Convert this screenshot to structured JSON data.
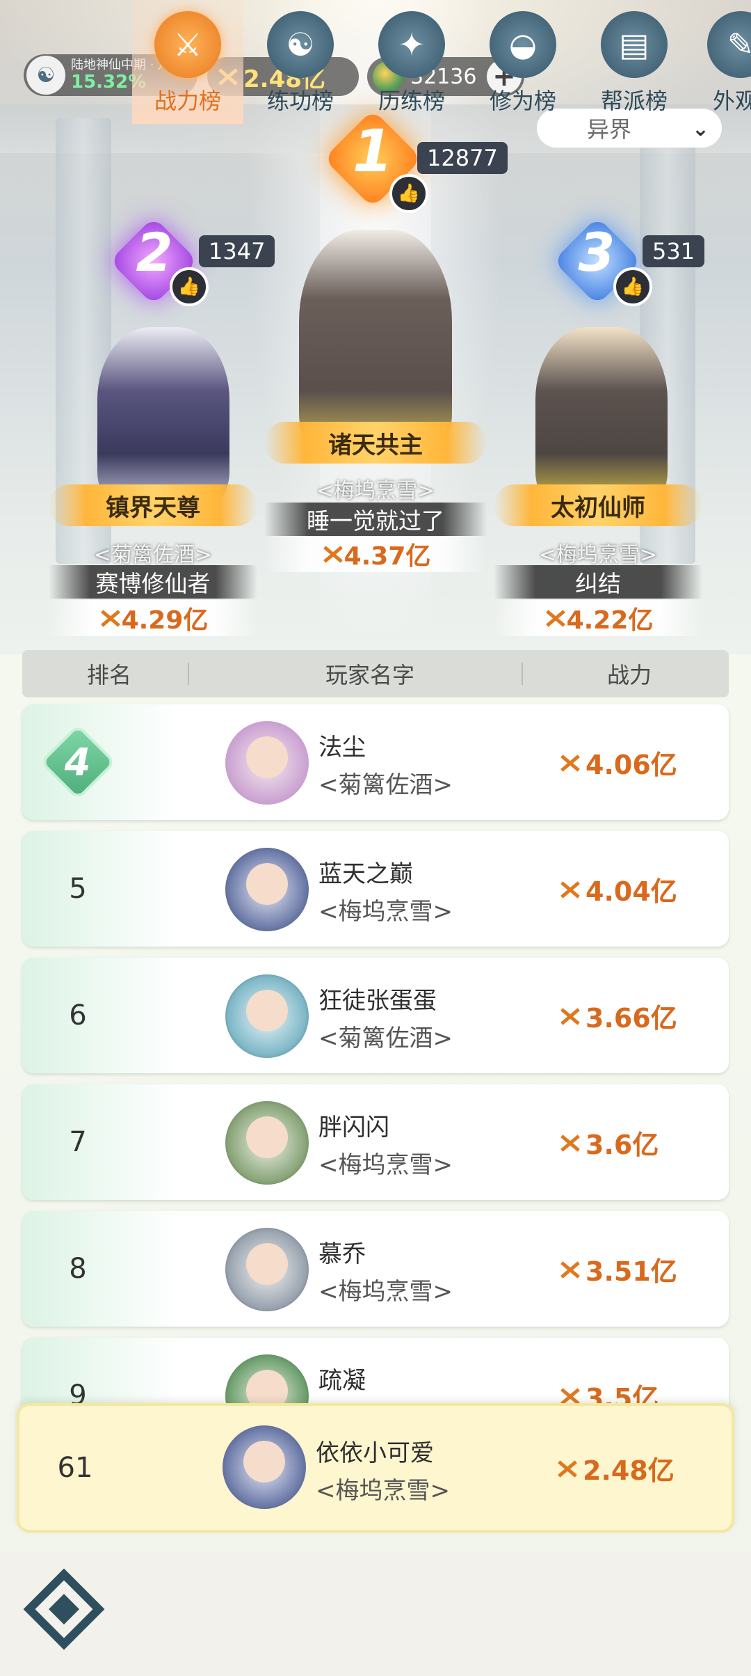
{
  "top_bar": {
    "realm_name": "陆地神仙中期 · 八重",
    "realm_progress": "15.32%",
    "power": "2.48亿",
    "coins": "32136",
    "add_label": "+"
  },
  "server_select": {
    "value": "异界"
  },
  "podium": [
    {
      "rank": "1",
      "likes": "12877",
      "title": "诸天共主",
      "guild": "<梅坞烹雪>",
      "name": "睡一觉就过了",
      "power": "4.37亿"
    },
    {
      "rank": "2",
      "likes": "1347",
      "title": "镇界天尊",
      "guild": "<菊篱佐酒>",
      "name": "赛博修仙者",
      "power": "4.29亿"
    },
    {
      "rank": "3",
      "likes": "531",
      "title": "太初仙师",
      "guild": "<梅坞烹雪>",
      "name": "纠结",
      "power": "4.22亿"
    }
  ],
  "table_header": {
    "rank": "排名",
    "name": "玩家名字",
    "power": "战力"
  },
  "rows": [
    {
      "rank": "4",
      "name": "法尘",
      "guild": "<菊篱佐酒>",
      "power": "4.06亿"
    },
    {
      "rank": "5",
      "name": "蓝天之巅",
      "guild": "<梅坞烹雪>",
      "power": "4.04亿"
    },
    {
      "rank": "6",
      "name": "狂徒张蛋蛋",
      "guild": "<菊篱佐酒>",
      "power": "3.66亿"
    },
    {
      "rank": "7",
      "name": "胖闪闪",
      "guild": "<梅坞烹雪>",
      "power": "3.6亿"
    },
    {
      "rank": "8",
      "name": "慕乔",
      "guild": "<梅坞烹雪>",
      "power": "3.51亿"
    },
    {
      "rank": "9",
      "name": "疏凝",
      "guild": "",
      "power": "3.5亿"
    }
  ],
  "my_row": {
    "rank": "61",
    "name": "依依小可爱",
    "guild": "<梅坞烹雪>",
    "power": "2.48亿"
  },
  "bottom_nav": [
    {
      "label": "战力榜",
      "icon": "crossed-swords-icon",
      "active": true
    },
    {
      "label": "练功榜",
      "icon": "yin-yang-icon",
      "active": false
    },
    {
      "label": "历练榜",
      "icon": "compass-star-icon",
      "active": false
    },
    {
      "label": "修为榜",
      "icon": "meditation-icon",
      "active": false
    },
    {
      "label": "帮派榜",
      "icon": "scroll-icon",
      "active": false
    },
    {
      "label": "外观",
      "icon": "brush-icon",
      "active": false
    }
  ],
  "colors": {
    "accent_orange": "#e0711c",
    "rank_green": "#4fae7c",
    "gold": "#ffd36a"
  }
}
